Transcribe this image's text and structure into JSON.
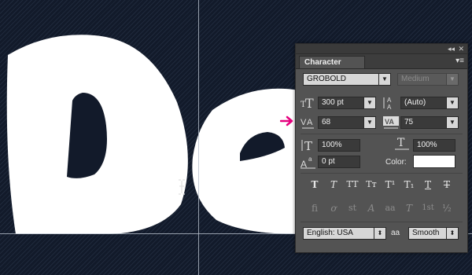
{
  "canvas": {
    "artwork_text": "De",
    "background": "#121a2a"
  },
  "panel": {
    "title": "Character",
    "font_family": "GROBOLD",
    "font_style": "Medium",
    "font_size": "300 pt",
    "leading": "(Auto)",
    "kerning": "68",
    "tracking": "75",
    "vertical_scale": "100%",
    "horizontal_scale": "100%",
    "baseline_shift": "0 pt",
    "color_label": "Color:",
    "color_value": "#ffffff",
    "language": "English: USA",
    "antialias": "Smooth",
    "aa_icon_text": "aa",
    "style_buttons": [
      "T",
      "T",
      "TT",
      "Tᴛ",
      "T¹",
      "T₁",
      "T",
      "T"
    ],
    "opentype_buttons": [
      "fi",
      "ơ",
      "st",
      "A",
      "aa",
      "T",
      "1st",
      "½"
    ]
  },
  "colors": {
    "accent_arrow": "#e6007e"
  }
}
